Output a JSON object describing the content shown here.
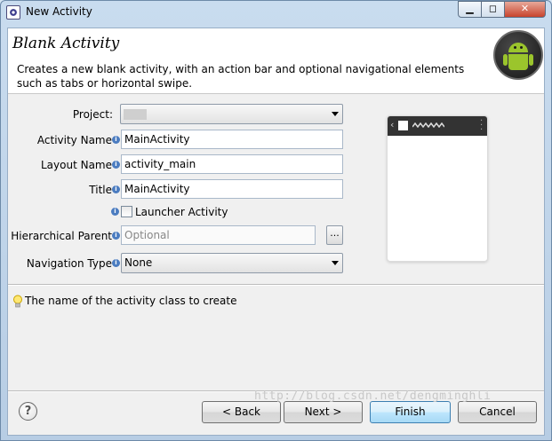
{
  "window": {
    "title": "New Activity",
    "controls": {
      "minimize": "▁",
      "maximize": "◻",
      "close": "✕"
    }
  },
  "header": {
    "title": "Blank Activity",
    "description": "Creates a new blank activity, with an action bar and optional navigational elements such as tabs or horizontal swipe.",
    "logo_icon": "android-logo"
  },
  "form": {
    "project": {
      "label": "Project:",
      "value": ""
    },
    "activity_name": {
      "label": "Activity Name",
      "value": "MainActivity"
    },
    "layout_name": {
      "label": "Layout Name",
      "value": "activity_main"
    },
    "title": {
      "label": "Title",
      "value": "MainActivity"
    },
    "launcher_activity": {
      "label": "Launcher Activity",
      "checked": false
    },
    "hierarchical_parent": {
      "label": "Hierarchical Parent",
      "placeholder": "Optional",
      "browse_label": "..."
    },
    "navigation_type": {
      "label": "Navigation Type",
      "value": "None"
    },
    "info_icon": "i"
  },
  "hint": {
    "text": "The name of the activity class to create",
    "icon": "lightbulb-icon"
  },
  "buttons": {
    "help": "?",
    "back": "< Back",
    "next": "Next >",
    "finish": "Finish",
    "cancel": "Cancel"
  },
  "watermark": "http://blog.csdn.net/dengminghli",
  "colors": {
    "android_green": "#9bc52c",
    "default_button": "#3c7fb1"
  }
}
